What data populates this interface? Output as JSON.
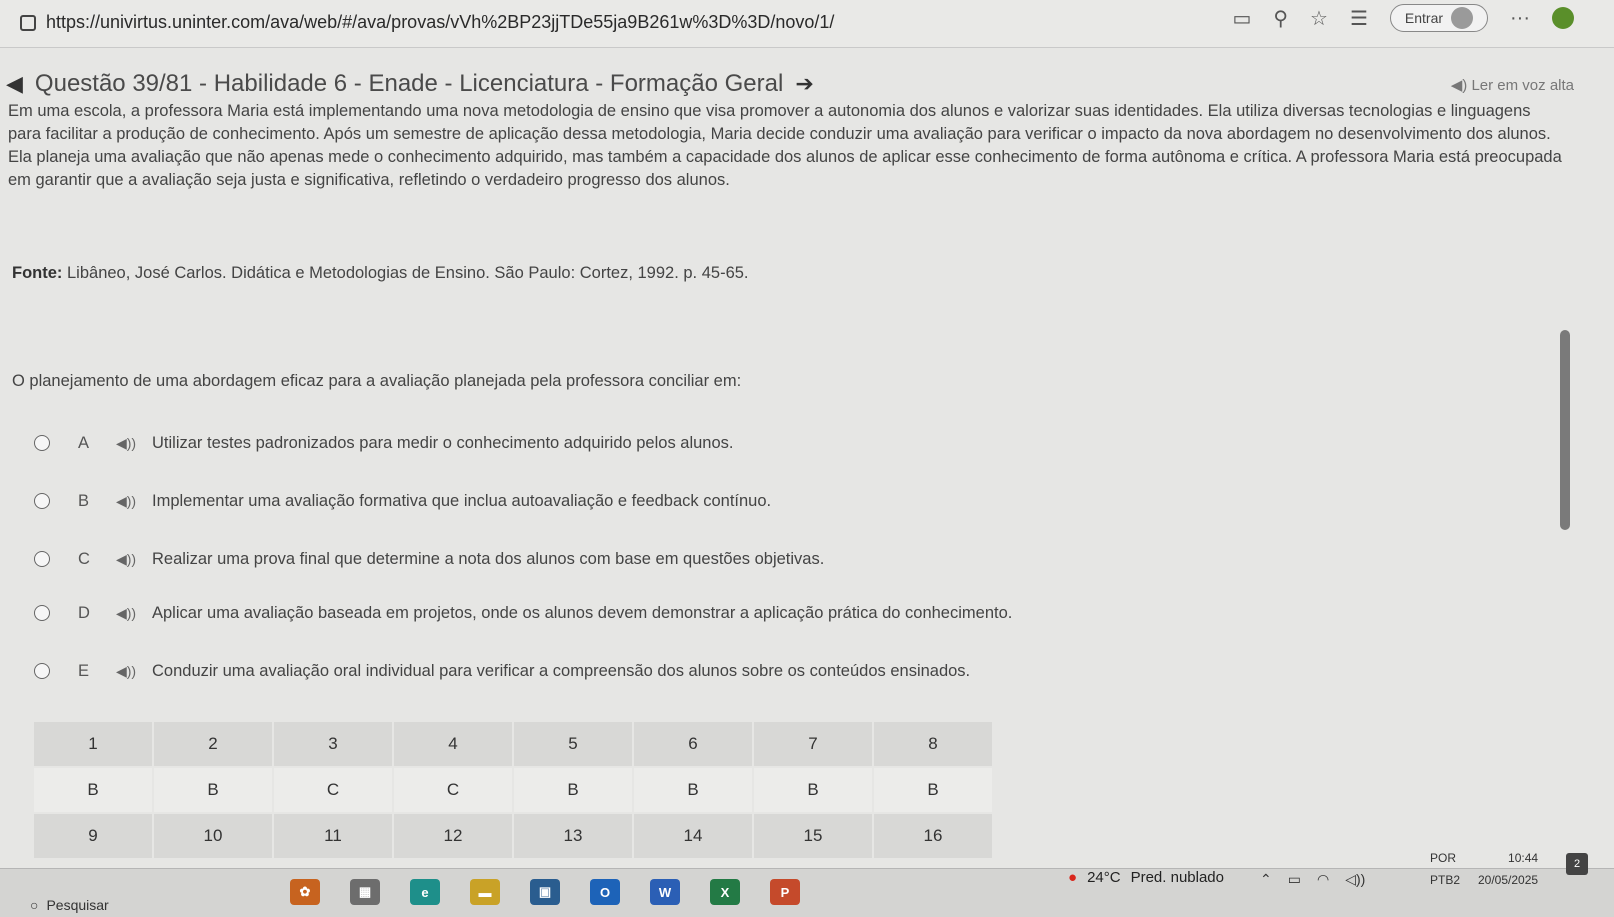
{
  "browser": {
    "url": "https://univirtus.uninter.com/ava/web/#/ava/provas/vVh%2BP23jjTDe55ja9B261w%3D%3D/novo/1/",
    "signin_label": "Entrar",
    "more_label": "···"
  },
  "header": {
    "title": "Questão 39/81 - Habilidade 6 - Enade - Licenciatura - Formação Geral",
    "read_aloud": "Ler em voz alta"
  },
  "body": {
    "paragraph": "Em uma escola, a professora Maria está implementando uma nova metodologia de ensino que visa promover a autonomia dos alunos e valorizar suas identidades. Ela utiliza diversas tecnologias e linguagens para facilitar a produção de conhecimento. Após um semestre de aplicação dessa metodologia, Maria decide conduzir uma avaliação para verificar o impacto da nova abordagem no desenvolvimento dos alunos. Ela planeja uma avaliação que não apenas mede o conhecimento adquirido, mas também a capacidade dos alunos de aplicar esse conhecimento de forma autônoma e crítica. A professora Maria está preocupada em garantir que a avaliação seja justa e significativa, refletindo o verdadeiro progresso dos alunos.",
    "fonte_label": "Fonte:",
    "fonte_text": "Libâneo, José Carlos. Didática e Metodologias de Ensino. São Paulo: Cortez, 1992. p. 45-65.",
    "question": "O planejamento de uma abordagem eficaz para a avaliação planejada pela professora conciliar em:"
  },
  "options": [
    {
      "letter": "A",
      "text": "Utilizar testes padronizados para medir o conhecimento adquirido pelos alunos."
    },
    {
      "letter": "B",
      "text": "Implementar uma avaliação formativa que inclua autoavaliação e feedback contínuo."
    },
    {
      "letter": "C",
      "text": "Realizar uma prova final que determine a nota dos alunos com base em questões objetivas."
    },
    {
      "letter": "D",
      "text": "Aplicar uma avaliação baseada em projetos, onde os alunos devem demonstrar a aplicação prática do conhecimento."
    },
    {
      "letter": "E",
      "text": "Conduzir uma avaliação oral individual para verificar a compreensão dos alunos sobre os conteúdos ensinados."
    }
  ],
  "answer_grid": {
    "row1_numbers": [
      "1",
      "2",
      "3",
      "4",
      "5",
      "6",
      "7",
      "8"
    ],
    "row1_answers": [
      "B",
      "B",
      "C",
      "C",
      "B",
      "B",
      "B",
      "B"
    ],
    "row2_numbers": [
      "9",
      "10",
      "11",
      "12",
      "13",
      "14",
      "15",
      "16"
    ]
  },
  "taskbar": {
    "search_label": "Pesquisar",
    "temperature": "24°C",
    "weather": "Pred. nublado",
    "lang_top": "POR",
    "lang_bottom": "PTB2",
    "time": "10:44",
    "date": "20/05/2025",
    "notif_count": "2"
  },
  "colors": {
    "accent_weather": "#d9261c",
    "numbered_cell": "#d8d8d6",
    "answer_cell": "#ececea"
  }
}
